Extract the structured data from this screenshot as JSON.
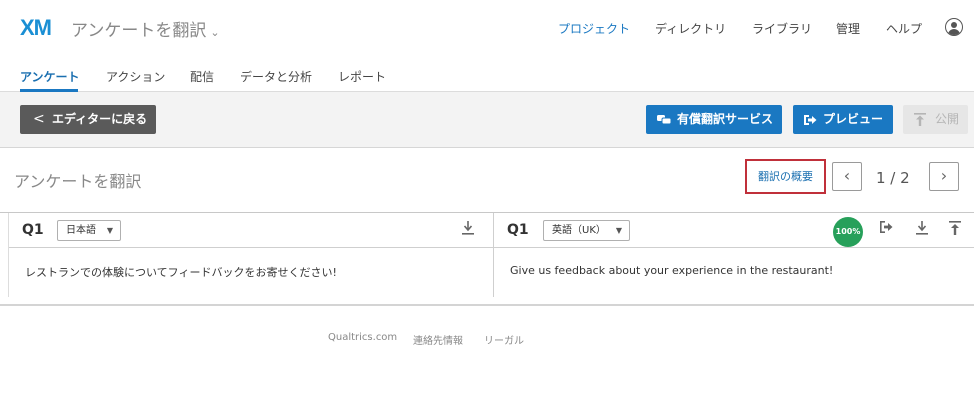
{
  "header": {
    "logo": "XM",
    "project_title": "アンケートを翻訳",
    "project_chevron": "⌄",
    "nav": [
      {
        "label": "プロジェクト",
        "active": true
      },
      {
        "label": "ディレクトリ"
      },
      {
        "label": "ライブラリ"
      },
      {
        "label": "管理"
      },
      {
        "label": "ヘルプ"
      }
    ],
    "user_icon": "user-circle-icon"
  },
  "subtabs": [
    {
      "label": "アンケート",
      "active": true
    },
    {
      "label": "アクション"
    },
    {
      "label": "配信"
    },
    {
      "label": "データと分析"
    },
    {
      "label": "レポート"
    }
  ],
  "toolbar": {
    "back_label": "エディターに戻る",
    "paid_translation_label": "有償翻訳サービス",
    "preview_label": "プレビュー",
    "publish_label": "公開"
  },
  "translate": {
    "title": "アンケートを翻訳",
    "overview_label": "翻訳の概要",
    "page_indicator": "1 / 2"
  },
  "panels": {
    "left": {
      "question_label": "Q1",
      "language": "日本語",
      "text": "レストランでの体験についてフィードバックをお寄せください!"
    },
    "right": {
      "question_label": "Q1",
      "language": "英語（UK）",
      "progress_badge": "100%",
      "progress": 1.0,
      "text": "Give us feedback about your experience in the restaurant!"
    }
  },
  "footer": {
    "links": [
      "Qualtrics.com",
      "連絡先情報",
      "リーガル"
    ]
  },
  "colors": {
    "accent": "#1a78c2",
    "highlight_border": "#c0303a",
    "success": "#27a05a",
    "dark_button": "#5a5a5a"
  }
}
